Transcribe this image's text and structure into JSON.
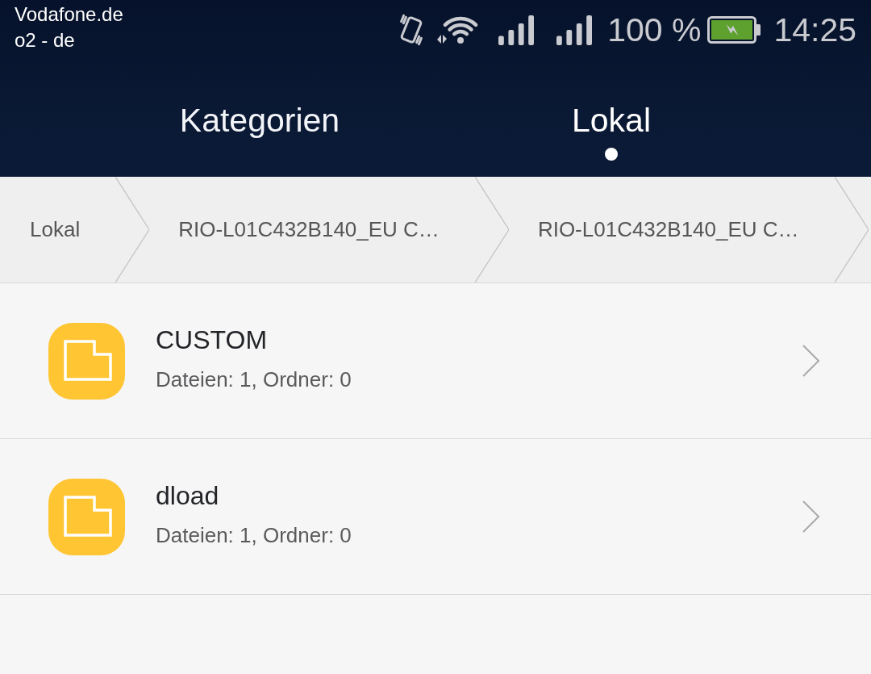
{
  "status_bar": {
    "carriers": [
      "Vodafone.de",
      "o2 - de"
    ],
    "battery_percent": "100 %",
    "time": "14:25"
  },
  "tabs": [
    {
      "label": "Kategorien",
      "selected": false
    },
    {
      "label": "Lokal",
      "selected": true
    }
  ],
  "breadcrumbs": [
    "Lokal",
    "RIO-L01C432B140_EU C…",
    "RIO-L01C432B140_EU C…"
  ],
  "folders": [
    {
      "name": "CUSTOM",
      "details": "Dateien: 1, Ordner: 0"
    },
    {
      "name": "dload",
      "details": "Dateien: 1, Ordner: 0"
    }
  ]
}
